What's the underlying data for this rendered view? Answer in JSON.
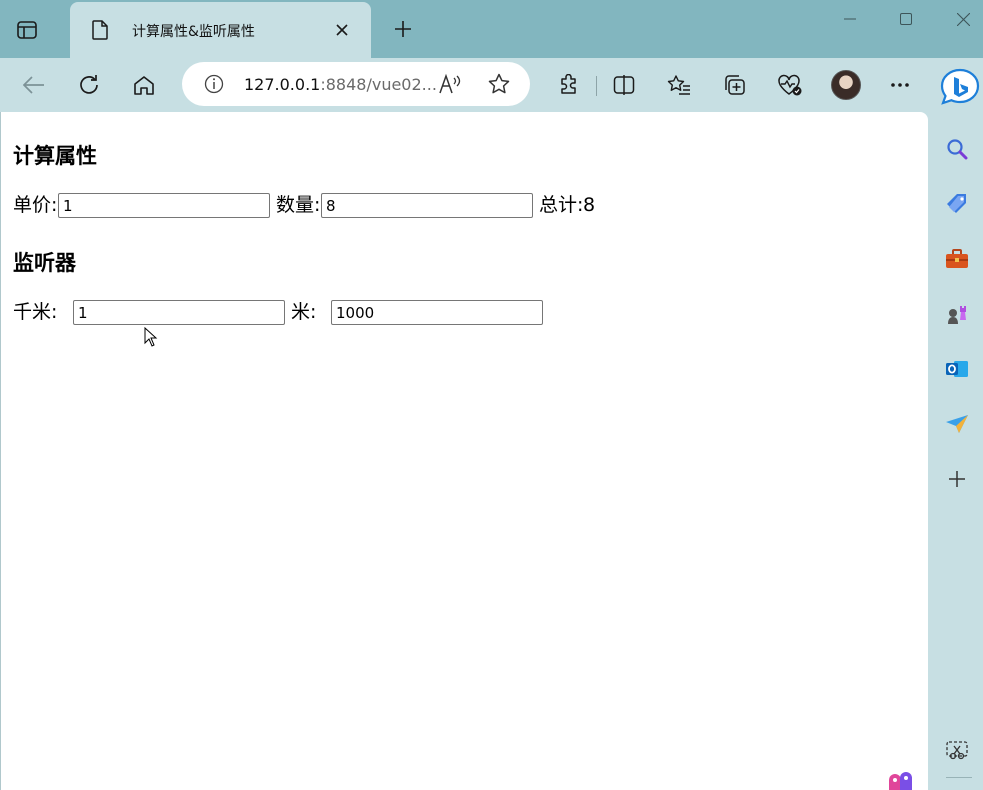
{
  "browser": {
    "tab": {
      "title": "计算属性&监听属性"
    },
    "address": {
      "host": "127.0.0.1",
      "rest": ":8848/vue02..."
    }
  },
  "page": {
    "computed_section": {
      "heading": "计算属性",
      "price_label": "单价:",
      "price_value": "1",
      "qty_label": "数量:",
      "qty_value": "8",
      "total_label": "总计:",
      "total_value": "8"
    },
    "watcher_section": {
      "heading": "监听器",
      "km_label": "千米:",
      "km_value": "1",
      "m_label": "米:",
      "m_value": "1000"
    }
  },
  "colors": {
    "tabstrip": "#82b6bf",
    "toolbar": "#c7dfe3",
    "page_bg": "#ffffff"
  },
  "icons": {
    "toolbar": [
      "back-icon",
      "refresh-icon",
      "home-icon",
      "info-icon",
      "read-aloud-icon",
      "favorite-star-icon",
      "extensions-icon",
      "split-screen-icon",
      "favorites-icon",
      "collections-icon",
      "browser-essentials-icon",
      "profile-avatar",
      "more-icon",
      "bing-copilot-icon"
    ],
    "sidebar": [
      "search-icon",
      "shopping-tag-icon",
      "tools-icon",
      "games-icon",
      "outlook-icon",
      "send-icon",
      "add-icon",
      "screenshot-icon"
    ]
  }
}
